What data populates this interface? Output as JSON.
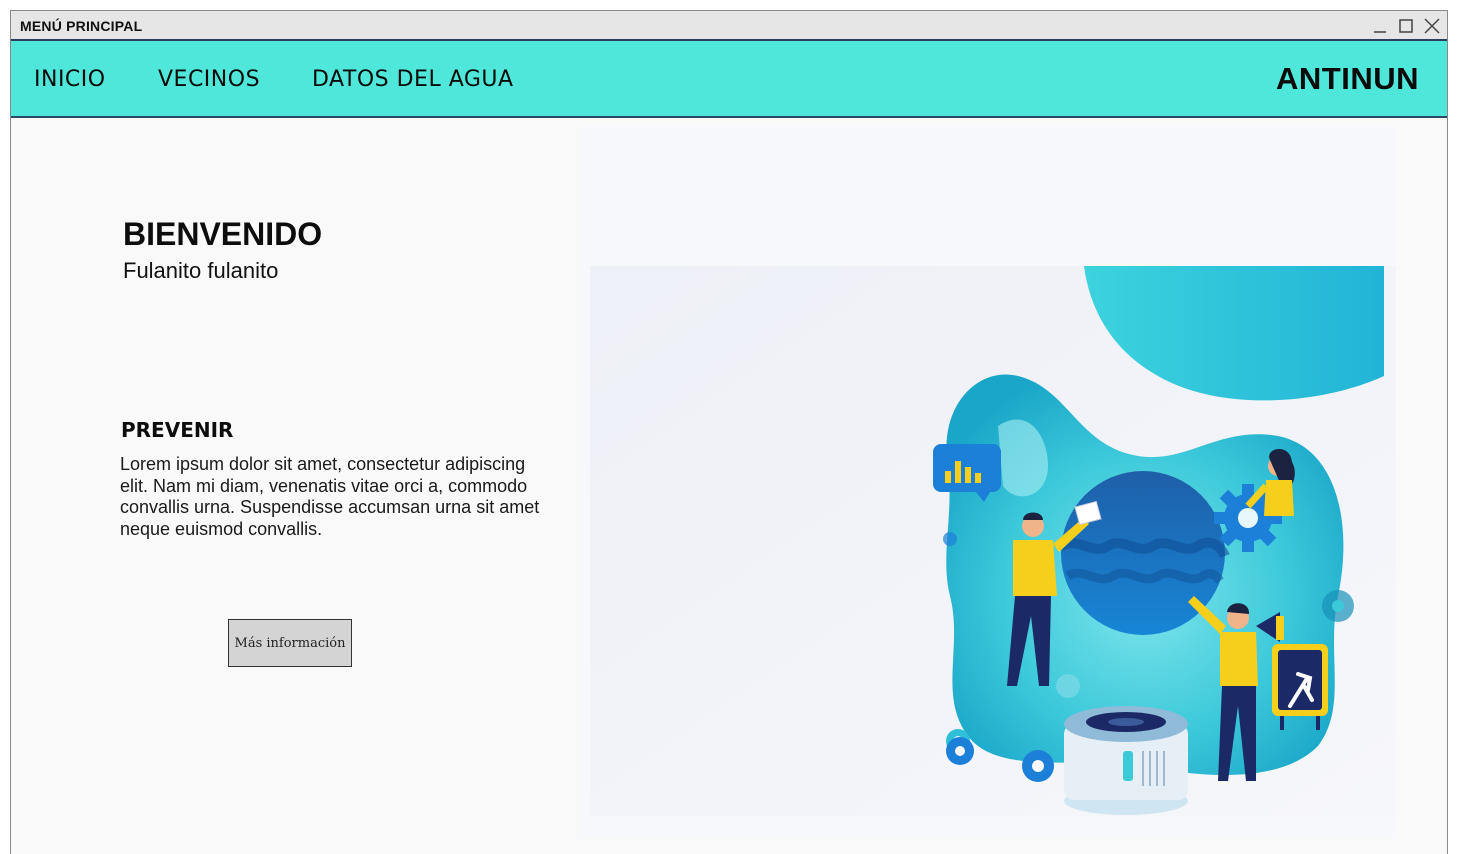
{
  "window": {
    "title": "MENÚ PRINCIPAL"
  },
  "nav": {
    "items": [
      {
        "label": "INICIO"
      },
      {
        "label": "VECINOS"
      },
      {
        "label": "DATOS DEL AGUA"
      }
    ],
    "brand": "ANTINUN"
  },
  "welcome": {
    "title": "BIENVENIDO",
    "subtitle": "Fulanito fulanito"
  },
  "section": {
    "title": "PREVENIR",
    "body": "Lorem ipsum dolor sit amet, consectetur adipiscing elit. Nam mi diam, venenatis vitae orci a, commodo convallis urna. Suspendisse accumsan urna sit amet neque euismod convallis.",
    "button_label": "Más información"
  },
  "colors": {
    "navbar": "#4ee7da",
    "accent_yellow": "#f5cf1b",
    "accent_blue": "#1683d6"
  },
  "icons": [
    "minimize-icon",
    "maximize-icon",
    "close-icon",
    "chart-icon",
    "gear-icon",
    "signpost-icon",
    "megaphone-icon"
  ]
}
